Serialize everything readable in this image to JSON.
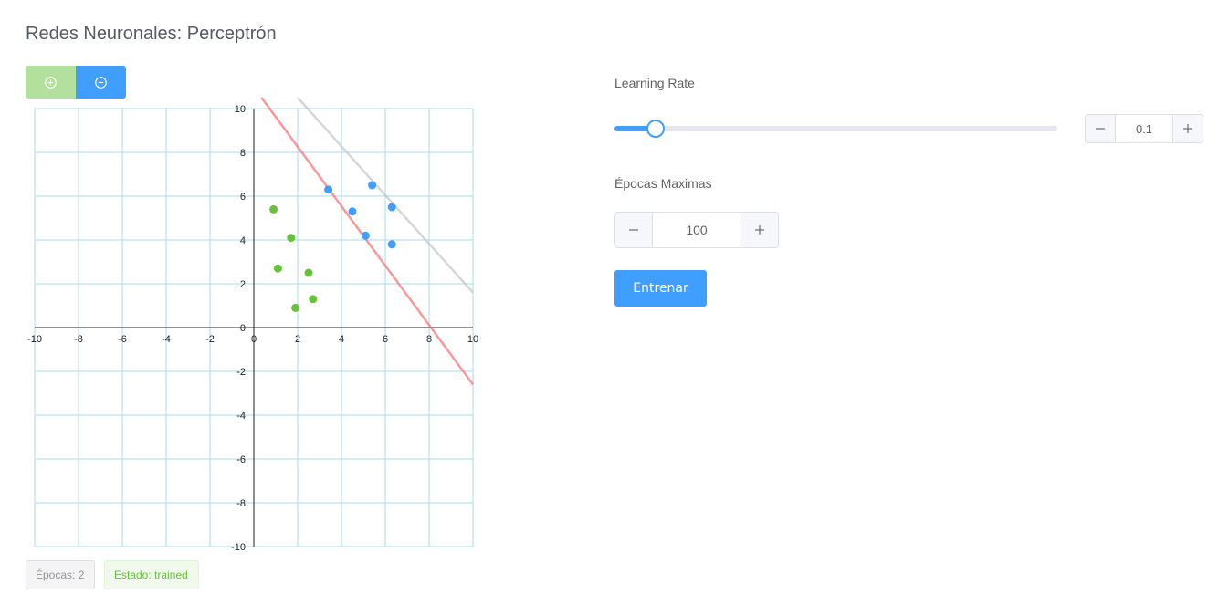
{
  "page": {
    "title": "Redes Neuronales: Perceptrón"
  },
  "toolbar": {
    "add_icon": "plus-circle-icon",
    "remove_icon": "minus-circle-icon"
  },
  "chart_data": {
    "type": "scatter",
    "title": "",
    "xlim": [
      -10,
      10
    ],
    "ylim": [
      -10,
      10
    ],
    "x_ticks": [
      "-10",
      "-8",
      "-6",
      "-4",
      "-2",
      "0",
      "2",
      "4",
      "6",
      "8",
      "10"
    ],
    "y_ticks": [
      "10",
      "8",
      "6",
      "4",
      "2",
      "0",
      "-2",
      "-4",
      "-6",
      "-8",
      "-10"
    ],
    "grid": true,
    "series": [
      {
        "color": "#67c23a",
        "points": [
          [
            0.9,
            5.4
          ],
          [
            1.7,
            4.1
          ],
          [
            1.1,
            2.7
          ],
          [
            2.5,
            2.5
          ],
          [
            2.7,
            1.3
          ],
          [
            1.9,
            0.9
          ]
        ]
      },
      {
        "color": "#409eff",
        "points": [
          [
            3.4,
            6.3
          ],
          [
            5.4,
            6.5
          ],
          [
            4.5,
            5.3
          ],
          [
            6.3,
            5.5
          ],
          [
            5.1,
            4.2
          ],
          [
            6.3,
            3.8
          ]
        ]
      }
    ],
    "lines": [
      {
        "color": "#f56c6c",
        "opacity": 0.7,
        "from": [
          0.35,
          10.5
        ],
        "to": [
          10,
          -2.6
        ]
      },
      {
        "color": "#c0c4cc",
        "opacity": 0.7,
        "from": [
          2.0,
          10.5
        ],
        "to": [
          10,
          1.6
        ]
      }
    ]
  },
  "status": {
    "epochs": "Épocas: 2",
    "state": "Estado: trained"
  },
  "learning_rate": {
    "label": "Learning Rate",
    "value": "0.1",
    "slider_fraction": 0.093
  },
  "max_epochs": {
    "label": "Épocas Maximas",
    "value": "100"
  },
  "train_button": {
    "label": "Entrenar"
  },
  "colors": {
    "accent": "#409eff",
    "success": "#67c23a",
    "danger": "#f56c6c",
    "grid": "#a8d8ea"
  }
}
